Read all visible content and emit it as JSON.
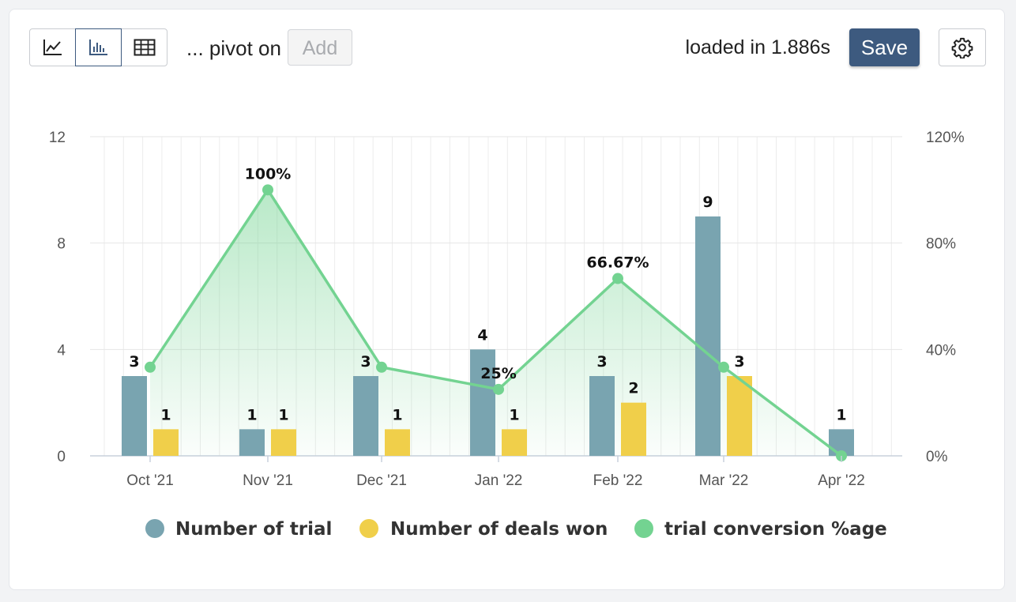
{
  "toolbar": {
    "view_buttons": [
      {
        "name": "line-chart",
        "icon": "line-chart-icon",
        "active": false
      },
      {
        "name": "bar-chart",
        "icon": "bar-chart-icon",
        "active": true
      },
      {
        "name": "table",
        "icon": "table-icon",
        "active": false
      }
    ],
    "pivot_label": "... pivot on",
    "add_label": "Add",
    "loaded_text": "loaded in 1.886s",
    "save_label": "Save",
    "settings_icon": "gear-icon"
  },
  "colors": {
    "trial": "#79a4b0",
    "deals_won": "#f0cf4a",
    "conversion": "#73d391",
    "accent": "#3d5a7f"
  },
  "chart_data": {
    "type": "bar",
    "categories": [
      "Oct '21",
      "Nov '21",
      "Dec '21",
      "Jan '22",
      "Feb '22",
      "Mar '22",
      "Apr '22"
    ],
    "series": [
      {
        "name": "Number of trial",
        "type": "bar",
        "axis": "left",
        "values": [
          3,
          1,
          3,
          4,
          3,
          9,
          1
        ]
      },
      {
        "name": "Number of deals won",
        "type": "bar",
        "axis": "left",
        "values": [
          1,
          1,
          1,
          1,
          2,
          3,
          null
        ]
      },
      {
        "name": "trial conversion %age",
        "type": "line",
        "axis": "right",
        "area": true,
        "values": [
          33.33,
          100,
          33.33,
          25,
          66.67,
          33.33,
          0
        ],
        "labels": [
          "",
          "100%",
          "",
          "25%",
          "66.67%",
          "",
          ""
        ]
      }
    ],
    "y_left": {
      "min": 0,
      "max": 12,
      "ticks": [
        "0",
        "4",
        "8",
        "12"
      ]
    },
    "y_right": {
      "min": 0,
      "max": 120,
      "ticks": [
        "0%",
        "40%",
        "80%",
        "120%"
      ]
    },
    "grid": true,
    "legend": "bottom"
  }
}
